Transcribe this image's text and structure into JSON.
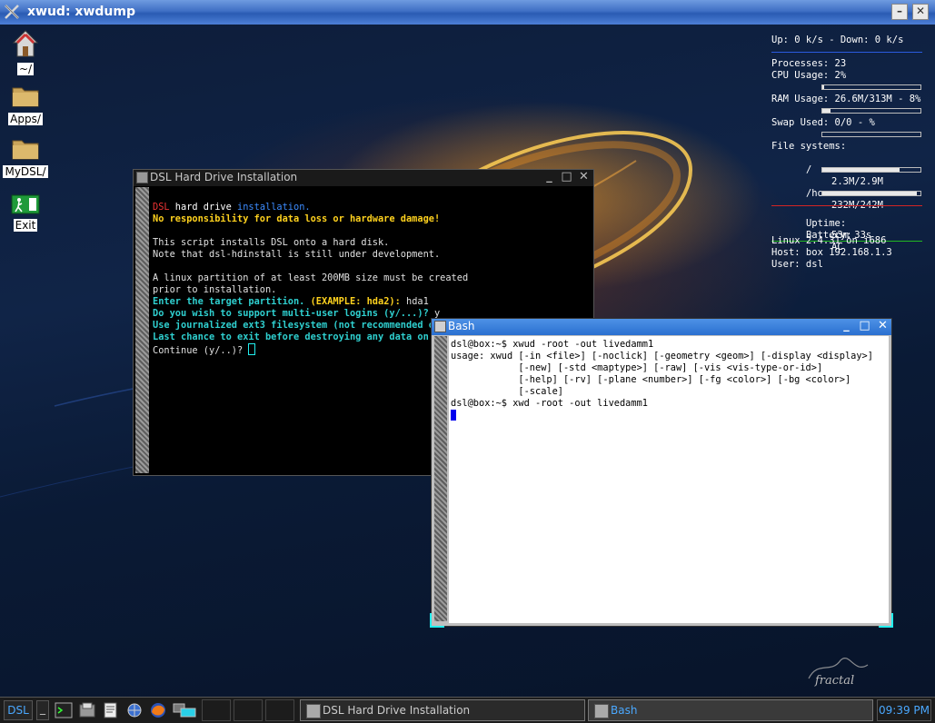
{
  "outer_window": {
    "title": "xwud: xwdump"
  },
  "desktop_icons": [
    {
      "label": "~/"
    },
    {
      "label": "Apps/"
    },
    {
      "label": "MyDSL/"
    },
    {
      "label": "Exit"
    }
  ],
  "conky": {
    "net": "Up: 0 k/s - Down: 0 k/s",
    "processes": "Processes: 23",
    "cpu": "CPU Usage: 2%",
    "ram": "RAM Usage: 26.6M/313M - 8%",
    "swap": "Swap Used: 0/0 - %",
    "fs_header": "File systems:",
    "fs_root_label": "/",
    "fs_root_value": "2.3M/2.9M",
    "fs_home_label": "/home",
    "fs_home_value": "232M/242M",
    "uptime_label": "Uptime:",
    "uptime_value": "53m 33s",
    "battery_label": "Battery:",
    "battery_value": "AC",
    "kernel": "Linux 2.4.31 on i686",
    "host": "Host: box 192.168.1.3",
    "user": "User: dsl",
    "levels": {
      "cpu": 0.02,
      "ram": 0.08,
      "swap": 0,
      "fs_root": 0.79,
      "fs_home": 0.96
    }
  },
  "install_window": {
    "title": "DSL Hard Drive Installation",
    "line1_dsl": "DSL",
    "line1_a": " hard drive ",
    "line1_b": "installation.",
    "line2": "No responsibility for data loss or hardware damage!",
    "line3": "This script installs DSL onto a hard disk.",
    "line4": "Note that dsl-hdinstall is still under development.",
    "line5": "A linux partition of at least 200MB size must be created",
    "line6": "prior to installation.",
    "line7_a": "Enter the target partition. ",
    "line7_b": "(EXAMPLE: ",
    "line7_c": "hda2",
    "line7_d": "): ",
    "line7_e": "hda1",
    "line8_a": "Do you wish to support multi-user logins (y/...)? ",
    "line8_b": "y",
    "line9": "Use journalized ext3 filesystem (not recommended on",
    "line10": "Last chance to exit before destroying any data on /",
    "line11": "Continue (y/..)? "
  },
  "bash_window": {
    "title": "Bash",
    "lines": [
      "dsl@box:~$ xwud -root -out livedamm1",
      "usage: xwud [-in <file>] [-noclick] [-geometry <geom>] [-display <display>]",
      "            [-new] [-std <maptype>] [-raw] [-vis <vis-type-or-id>]",
      "            [-help] [-rv] [-plane <number>] [-fg <color>] [-bg <color>]",
      "            [-scale]",
      "dsl@box:~$ xwd -root -out livedamm1"
    ]
  },
  "taskbar": {
    "start_label": "DSL",
    "minimize_label": "_",
    "tasks": [
      "DSL Hard Drive Installation",
      "Bash"
    ],
    "clock": "09:39 PM"
  },
  "signature": "fractal"
}
